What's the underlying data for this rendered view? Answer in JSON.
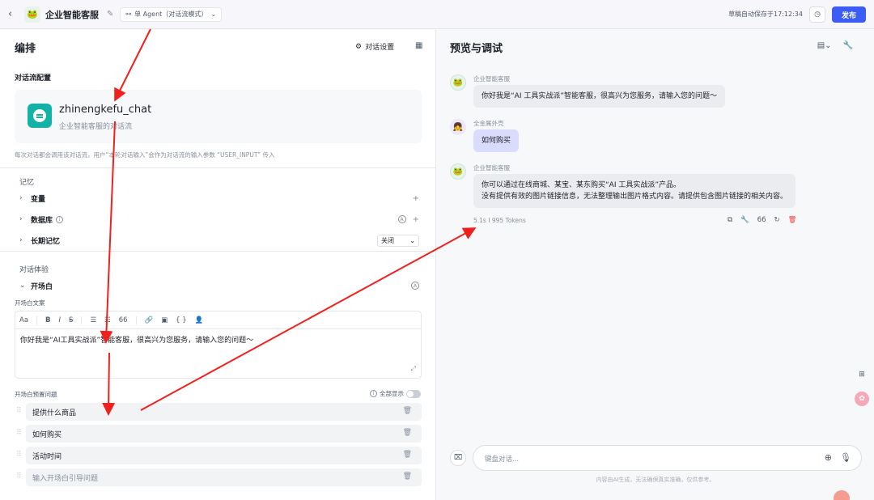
{
  "topbar": {
    "back_icon": "chevron-left-icon",
    "app_title": "企业智能客服",
    "mode_label": "单 Agent（对话流模式）",
    "save_status": "草稿自动保存于17:12:34",
    "publish_label": "发布"
  },
  "left": {
    "title": "编排",
    "dialog_settings_label": "对话设置",
    "flow_section_title": "对话流配置",
    "flow": {
      "name": "zhinengkefu_chat",
      "desc": "企业智能客服的对话流",
      "note": "每次对话都会调用该对话流，用户“本轮对话输入”会作为对话流的输入参数 “USER_INPUT” 传入"
    },
    "memory_label": "记忆",
    "rows": {
      "variables": "变量",
      "database": "数据库",
      "longterm": "长期记忆",
      "longterm_value": "关闭"
    },
    "experience_label": "对话体验",
    "opening_label": "开场白",
    "opening_text_label": "开场白文案",
    "toolbar": [
      "Aa",
      "B",
      "I",
      "S",
      "☰",
      "☷",
      "66",
      "🔗",
      "▣",
      "{ }",
      "👤"
    ],
    "opening_text": "你好我是“AI工具实战派”智能客服，很高兴为您服务，请输入您的问题～",
    "preset_questions_label": "开场白预置问题",
    "show_all_label": "全部显示",
    "questions": [
      "提供什么商品",
      "如何购买",
      "活动时间"
    ],
    "question_placeholder": "输入开场白引导问题"
  },
  "right": {
    "title": "预览与调试",
    "messages": [
      {
        "sender": "企业智能客服",
        "role": "bot",
        "text": "你好我是“AI 工具实战派”智能客服，很高兴为您服务，请输入您的问题～"
      },
      {
        "sender": "全金属外壳",
        "role": "user",
        "text": "如何购买"
      },
      {
        "sender": "企业智能客服",
        "role": "bot",
        "line1": "你可以通过在线商城、某宝、某东购买“AI 工具实战派”产品。",
        "line2": "没有提供有效的图片链接信息，无法整理输出图片格式内容。请提供包含图片链接的相关内容。"
      }
    ],
    "meta": "5.1s  I  995 Tokens",
    "input_placeholder": "键盘对话...",
    "disclaimer": "内容由AI生成，无法确保真实准确，仅供参考。"
  },
  "colors": {
    "primary": "#3b5cf6",
    "flow_icon": "#12b3a6",
    "user_bubble": "#d9dcfc",
    "arrow": "#f0201c",
    "delete": "#f53f3f"
  }
}
